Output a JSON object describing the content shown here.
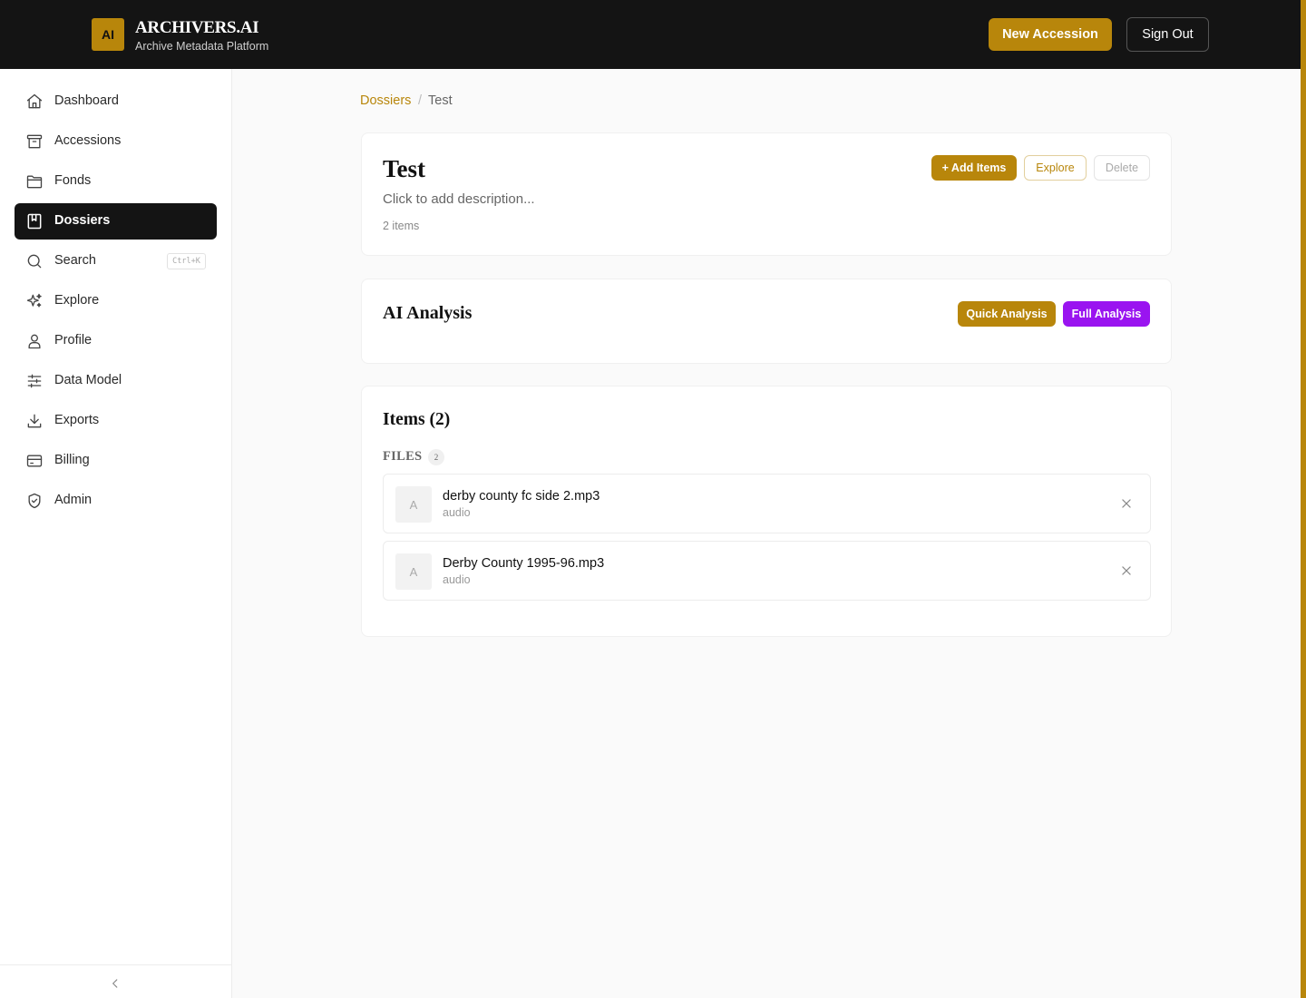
{
  "header": {
    "logo_text": "AI",
    "brand_name": "ARCHIVERS.AI",
    "brand_subtitle": "Archive Metadata Platform",
    "new_accession_label": "New Accession",
    "sign_out_label": "Sign Out",
    "accent_color": "#b8860b"
  },
  "sidebar": {
    "items": [
      {
        "label": "Dashboard",
        "icon": "home-icon"
      },
      {
        "label": "Accessions",
        "icon": "archive-box-icon"
      },
      {
        "label": "Fonds",
        "icon": "folder-icon"
      },
      {
        "label": "Dossiers",
        "icon": "book-bookmark-icon",
        "active": true
      },
      {
        "label": "Search",
        "icon": "search-icon",
        "shortcut": "Ctrl+K"
      },
      {
        "label": "Explore",
        "icon": "sparkles-icon"
      },
      {
        "label": "Profile",
        "icon": "user-icon"
      },
      {
        "label": "Data Model",
        "icon": "sliders-icon"
      },
      {
        "label": "Exports",
        "icon": "download-icon"
      },
      {
        "label": "Billing",
        "icon": "credit-card-icon"
      },
      {
        "label": "Admin",
        "icon": "shield-check-icon"
      }
    ],
    "collapse_icon": "chevron-left-icon"
  },
  "breadcrumb": {
    "parent": "Dossiers",
    "separator": "/",
    "current": "Test"
  },
  "dossier": {
    "title": "Test",
    "description_placeholder": "Click to add description...",
    "item_count": "2 items",
    "add_items_label": "+ Add Items",
    "explore_label": "Explore",
    "delete_label": "Delete"
  },
  "ai_analysis": {
    "title": "AI Analysis",
    "quick_label": "Quick Analysis",
    "full_label": "Full Analysis",
    "full_color": "#9a14f0"
  },
  "items": {
    "title": "Items (2)",
    "files_label": "FILES",
    "files_count": "2",
    "files": [
      {
        "thumb": "A",
        "name": "derby county fc side 2.mp3",
        "type": "audio"
      },
      {
        "thumb": "A",
        "name": "Derby County 1995-96.mp3",
        "type": "audio"
      }
    ]
  }
}
